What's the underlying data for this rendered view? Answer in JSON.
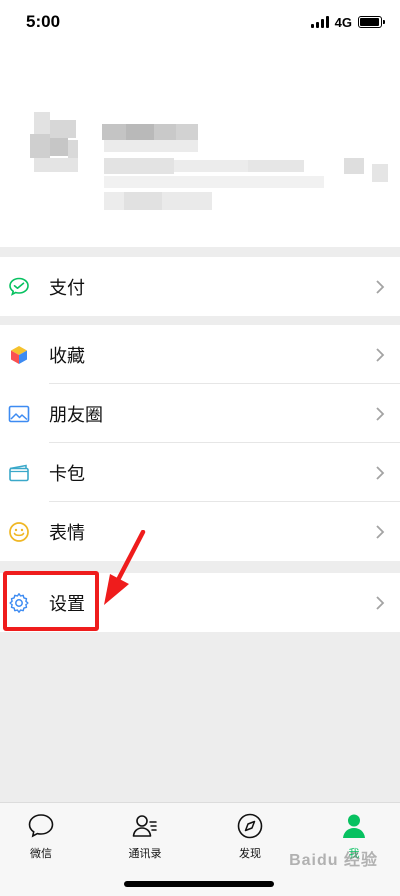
{
  "status_bar": {
    "time": "5:00",
    "network": "4G",
    "battery_level_pct": 95
  },
  "menu": {
    "pay": {
      "label": "支付",
      "icon": "wechat-pay-icon"
    },
    "favorites": {
      "label": "收藏",
      "icon": "favorites-cube-icon"
    },
    "moments": {
      "label": "朋友圈",
      "icon": "picture-icon"
    },
    "cards": {
      "label": "卡包",
      "icon": "card-wallet-icon"
    },
    "stickers": {
      "label": "表情",
      "icon": "smiley-icon"
    },
    "settings": {
      "label": "设置",
      "icon": "gear-icon"
    }
  },
  "tabbar": {
    "items": [
      {
        "label": "微信",
        "icon": "chat-bubble-icon",
        "active": false
      },
      {
        "label": "通讯录",
        "icon": "contacts-icon",
        "active": false
      },
      {
        "label": "发现",
        "icon": "compass-icon",
        "active": false
      },
      {
        "label": "我",
        "icon": "person-icon",
        "active": true
      }
    ]
  },
  "watermark": "Baidu 经验",
  "colors": {
    "accent_green": "#07c160",
    "highlight_red": "#ef1c1c",
    "background": "#ededed"
  }
}
